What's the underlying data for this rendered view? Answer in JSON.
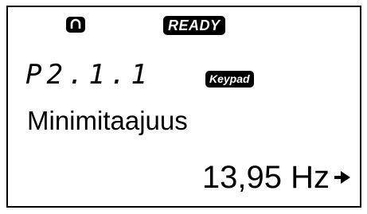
{
  "status": {
    "ready_label": "READY",
    "status_icon": "rotation-icon"
  },
  "parameter": {
    "code": "P2.1.1",
    "control_place": "Keypad",
    "name": "Minimitaajuus",
    "value": "13,95 Hz",
    "nav_icon": "arrow-right-icon"
  }
}
